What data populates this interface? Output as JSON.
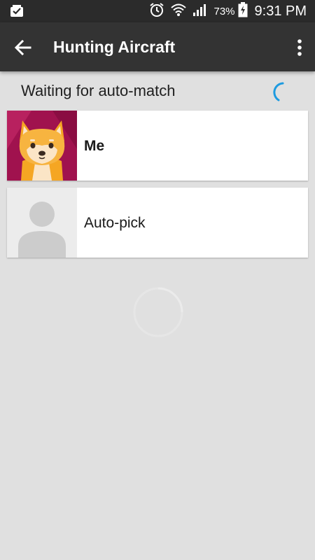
{
  "status_bar": {
    "notification_icon": "notification-inbox-icon",
    "icons": [
      "alarm-icon",
      "wifi-icon",
      "signal-icon",
      "battery-charging-icon"
    ],
    "battery_percent": "73%",
    "time": "9:31 PM"
  },
  "app_bar": {
    "back_icon": "arrow-back-icon",
    "title": "Hunting Aircraft",
    "overflow_icon": "more-vert-icon"
  },
  "waiting": {
    "title": "Waiting for auto-match",
    "spinner_color": "#1e9be0"
  },
  "players": [
    {
      "name": "Me",
      "avatar": "shiba-dog-avatar",
      "avatar_bg": "#a0124e"
    },
    {
      "name": "Auto-pick",
      "avatar": "person-placeholder-icon"
    }
  ],
  "colors": {
    "app_bar": "#333333",
    "status_bar": "#2b2b2b",
    "background": "#e0e0e0",
    "accent": "#1e9be0"
  }
}
